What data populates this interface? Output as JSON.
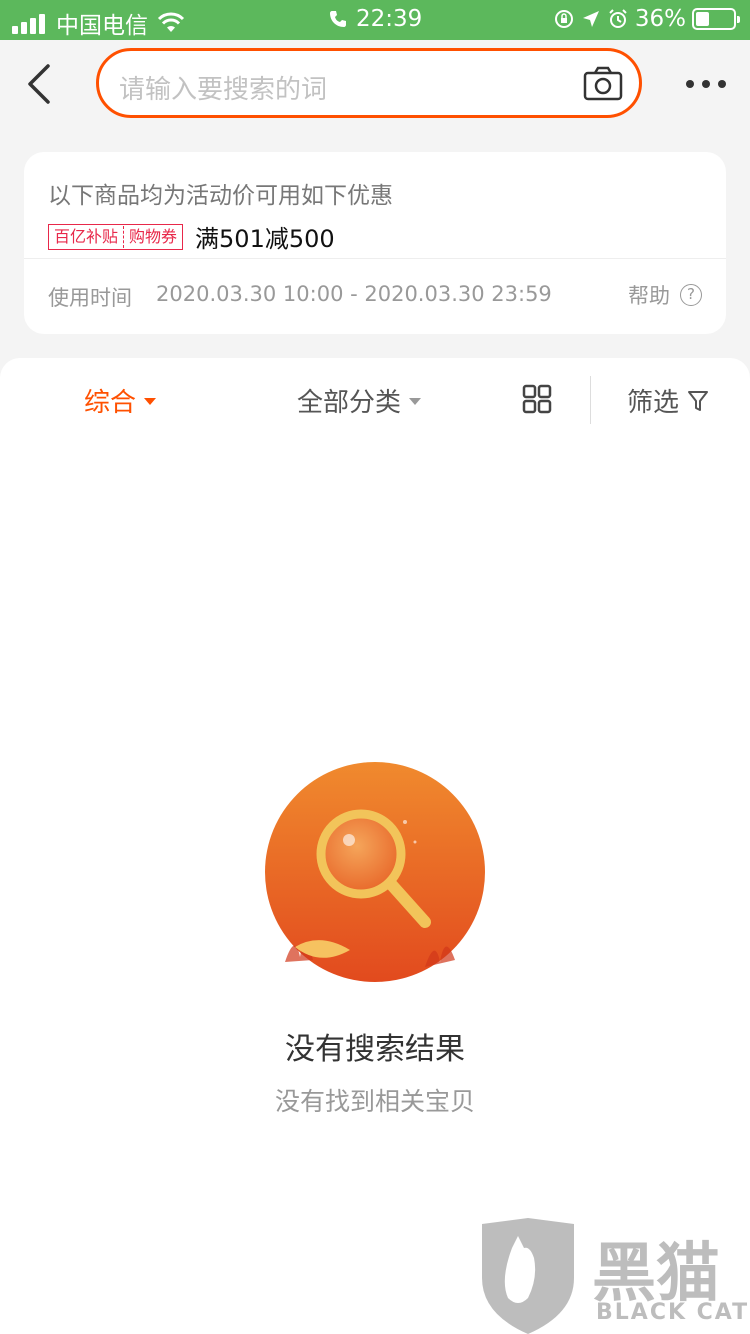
{
  "status_bar": {
    "carrier": "中国电信",
    "time": "22:39",
    "battery": "36%",
    "battery_level": 0.36
  },
  "header": {
    "search_placeholder": "请输入要搜索的词",
    "icons": [
      "back-icon",
      "camera-icon",
      "more-icon"
    ]
  },
  "promo": {
    "description": "以下商品均为活动价可用如下优惠",
    "tag_left": "百亿补贴",
    "tag_right": "购物券",
    "deal": "满501减500",
    "time_label": "使用时间",
    "time_range": "2020.03.30 10:00 - 2020.03.30 23:59",
    "help_label": "帮助",
    "help_icon_glyph": "?"
  },
  "sort_bar": {
    "all": "综合",
    "category": "全部分类",
    "filter": "筛选"
  },
  "empty_state": {
    "title": "没有搜索结果",
    "subtitle": "没有找到相关宝贝"
  },
  "watermark": {
    "cn": "黑猫",
    "en": "BLACK CAT"
  },
  "colors": {
    "accent": "#ff5000",
    "status_bar": "#5cb85c",
    "tag_red": "#e8284a"
  }
}
